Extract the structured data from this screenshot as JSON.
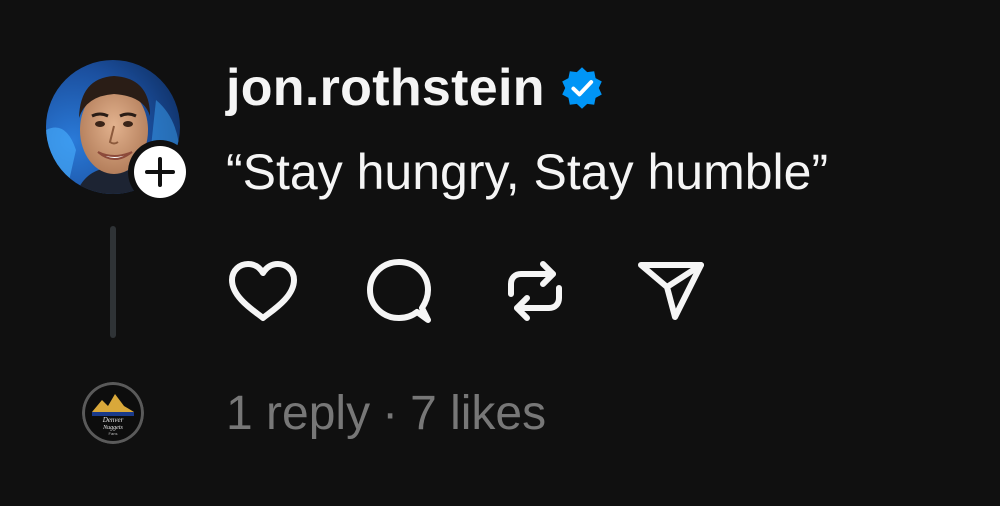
{
  "post": {
    "username": "jon.rothstein",
    "verified": true,
    "caption": "“Stay hungry, Stay humble”",
    "follow_icon": "plus-icon",
    "actions": [
      {
        "name": "like",
        "icon": "heart-icon"
      },
      {
        "name": "reply",
        "icon": "comment-icon"
      },
      {
        "name": "repost",
        "icon": "repost-icon"
      },
      {
        "name": "share",
        "icon": "send-icon"
      }
    ],
    "stats": {
      "replies": "1 reply",
      "separator": "·",
      "likes": "7 likes"
    },
    "reply_avatar_text": {
      "line1": "Denver",
      "line2": "Nuggets",
      "line3": "Fans"
    }
  },
  "colors": {
    "background": "#101010",
    "text_primary": "#f5f5f5",
    "text_secondary": "#777777",
    "verified_blue": "#0095f6",
    "thread_line": "#2f3336"
  }
}
